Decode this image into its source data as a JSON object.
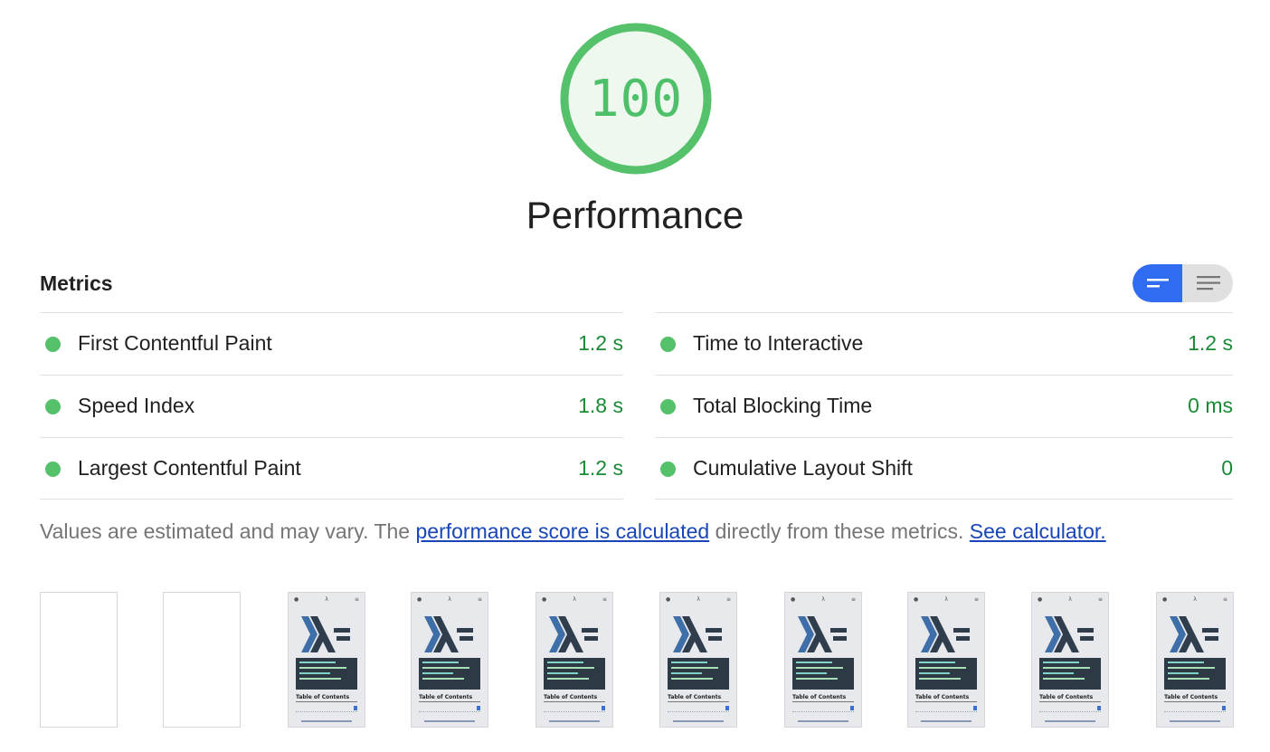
{
  "score": {
    "value": "100",
    "category_title": "Performance",
    "color": "#4fc06a"
  },
  "metrics": {
    "title": "Metrics",
    "toggle": {
      "options": [
        "summary-view",
        "detailed-view"
      ],
      "active": "summary-view"
    },
    "left": [
      {
        "name": "First Contentful Paint",
        "value": "1.2 s"
      },
      {
        "name": "Speed Index",
        "value": "1.8 s"
      },
      {
        "name": "Largest Contentful Paint",
        "value": "1.2 s"
      }
    ],
    "right": [
      {
        "name": "Time to Interactive",
        "value": "1.2 s"
      },
      {
        "name": "Total Blocking Time",
        "value": "0 ms"
      },
      {
        "name": "Cumulative Layout Shift",
        "value": "0"
      }
    ],
    "status_color": "#55c16b"
  },
  "note": {
    "prefix": "Values are estimated and may vary. The ",
    "link1": "performance score is calculated",
    "middle": " directly from these metrics. ",
    "link2": "See calculator."
  },
  "filmstrip": {
    "frames": [
      "blank",
      "blank",
      "loaded",
      "loaded",
      "loaded",
      "loaded",
      "loaded",
      "loaded",
      "loaded",
      "loaded"
    ],
    "thumbnail_heading": "Table of Contents"
  }
}
